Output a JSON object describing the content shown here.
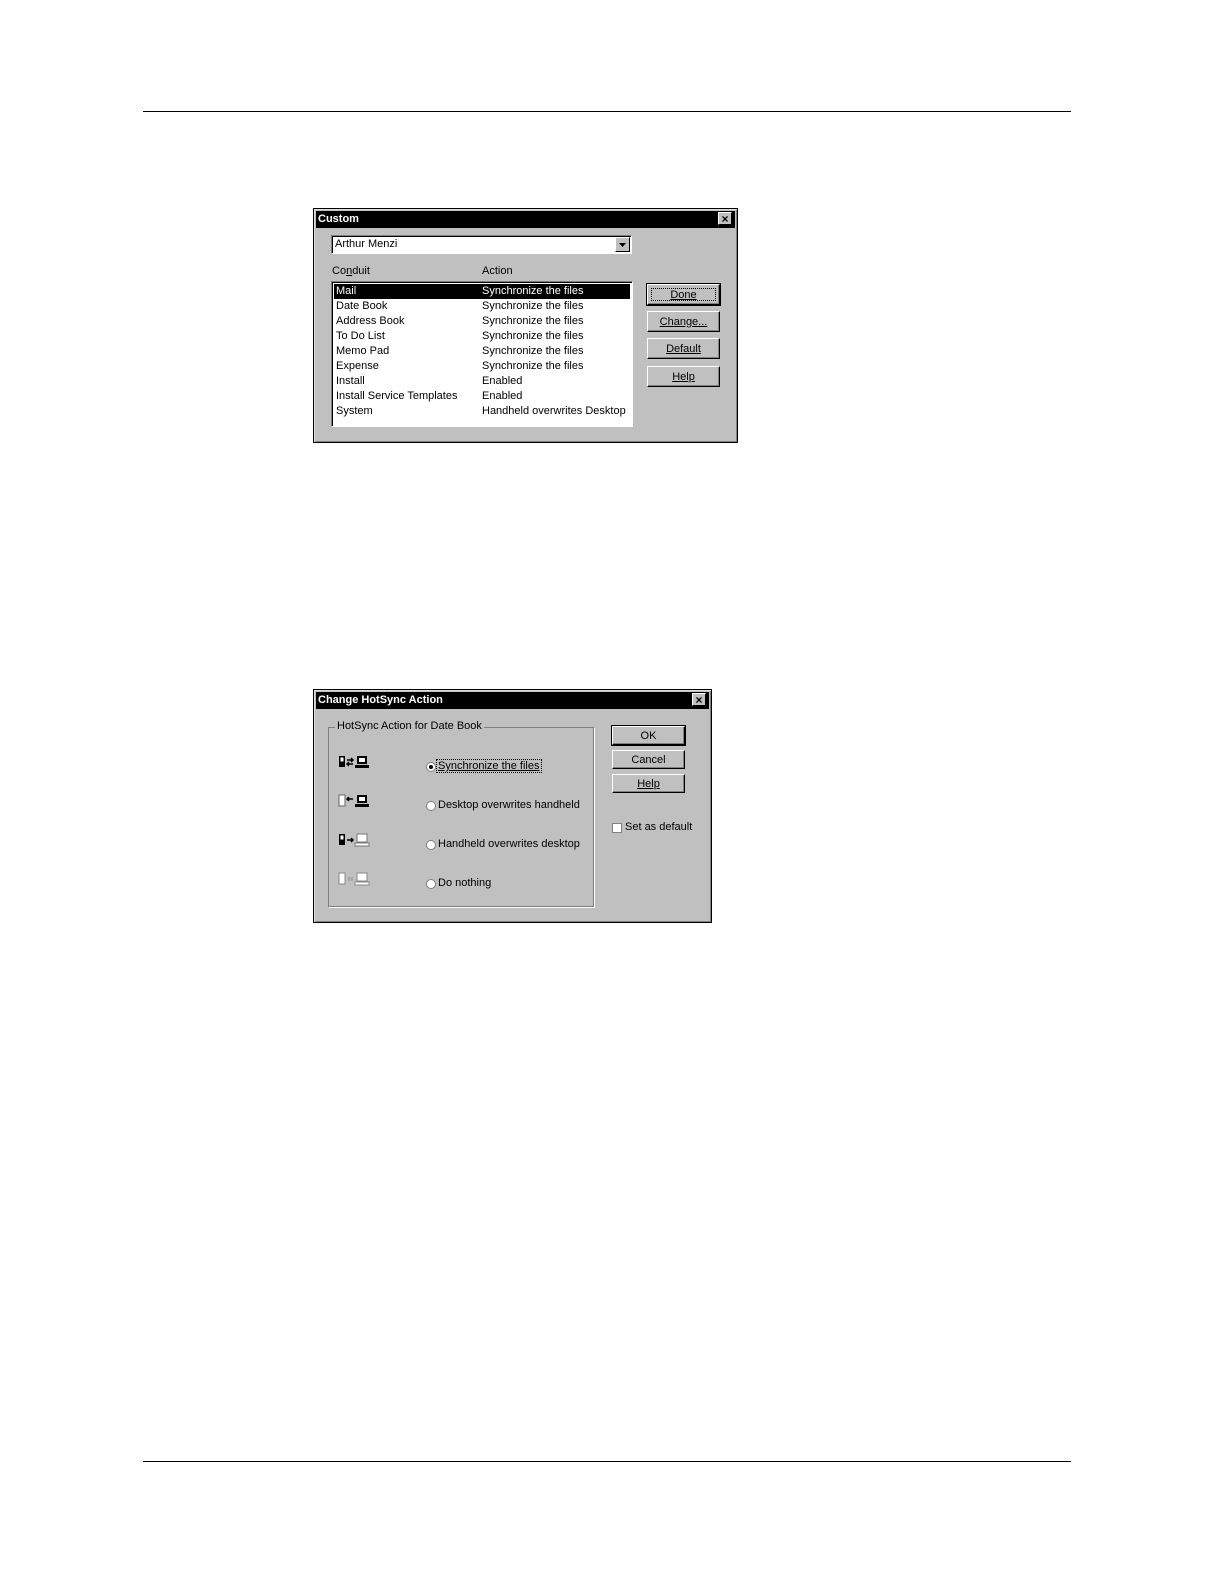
{
  "custom_dialog": {
    "title": "Custom",
    "user": "Arthur Menzi",
    "col_conduit_pre": "Co",
    "col_conduit_u": "n",
    "col_conduit_post": "duit",
    "col_action": "Action",
    "rows": [
      {
        "conduit": "Mail",
        "action": "Synchronize the files"
      },
      {
        "conduit": "Date Book",
        "action": "Synchronize the files"
      },
      {
        "conduit": "Address Book",
        "action": "Synchronize the files"
      },
      {
        "conduit": "To Do List",
        "action": "Synchronize the files"
      },
      {
        "conduit": "Memo Pad",
        "action": "Synchronize the files"
      },
      {
        "conduit": "Expense",
        "action": "Synchronize the files"
      },
      {
        "conduit": "Install",
        "action": "Enabled"
      },
      {
        "conduit": "Install Service Templates",
        "action": "Enabled"
      },
      {
        "conduit": "System",
        "action": "Handheld overwrites Desktop"
      }
    ],
    "buttons": {
      "done": "Done",
      "change": "Change...",
      "default": "Default",
      "help": "Help"
    }
  },
  "change_dialog": {
    "title": "Change HotSync Action",
    "group_label": "HotSync Action for Date Book",
    "options": [
      {
        "label": "Synchronize the files",
        "selected": true,
        "icon": "sync-both-icon"
      },
      {
        "label": "Desktop overwrites handheld",
        "selected": false,
        "icon": "desktop-to-handheld-icon"
      },
      {
        "label": "Handheld overwrites desktop",
        "selected": false,
        "icon": "handheld-to-desktop-icon"
      },
      {
        "label": "Do nothing",
        "selected": false,
        "icon": "do-nothing-icon"
      }
    ],
    "buttons": {
      "ok": "OK",
      "cancel": "Cancel",
      "help": "Help"
    },
    "set_default_label": "Set as default"
  }
}
